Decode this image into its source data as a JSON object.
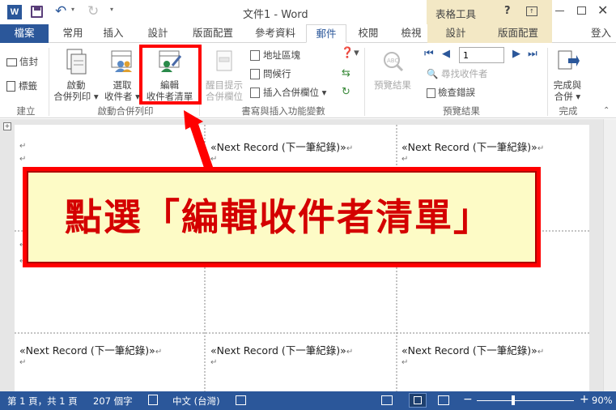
{
  "title_bar": {
    "title": "文件1 - Word",
    "table_tools": "表格工具",
    "help": "?"
  },
  "tabs": {
    "file": "檔案",
    "home": "常用",
    "insert": "插入",
    "design": "設計",
    "page_layout": "版面配置",
    "references": "參考資料",
    "mailings": "郵件",
    "review": "校閱",
    "view": "檢視",
    "tbl_design": "設計",
    "tbl_layout": "版面配置",
    "signin": "登入"
  },
  "ribbon": {
    "create": {
      "envelopes": "信封",
      "labels": "標籤",
      "group": "建立"
    },
    "start": {
      "start_mm_1": "啟動",
      "start_mm_2": "合併列印",
      "select_1": "選取",
      "select_2": "收件者",
      "edit_1": "編輯",
      "edit_2": "收件者清單",
      "group": "啟動合併列印"
    },
    "write": {
      "highlight_1": "醒目提示",
      "highlight_2": "合併欄位",
      "address_block": "地址區塊",
      "greeting_line": "問候行",
      "insert_field": "插入合併欄位",
      "group": "書寫與插入功能變數"
    },
    "preview": {
      "preview_results": "預覽結果",
      "record_no": "1",
      "find_recipient": "尋找收件者",
      "check_errors": "檢查錯誤",
      "group": "預覽結果"
    },
    "finish": {
      "finish_1": "完成與",
      "finish_2": "合併",
      "group": "完成"
    }
  },
  "document": {
    "record_text": "«Next Record (下一筆紀錄)»",
    "para_mark": "↵"
  },
  "callout": {
    "text": "點選「編輯收件者清單」"
  },
  "status": {
    "page": "第 1 頁，共 1 頁",
    "words": "207 個字",
    "lang": "中文 (台灣)",
    "zoom": "90%"
  },
  "colors": {
    "word_blue": "#2b579a",
    "callout_red": "#ff0000",
    "callout_fill": "#fdfbc6",
    "callout_text": "#d40000"
  }
}
